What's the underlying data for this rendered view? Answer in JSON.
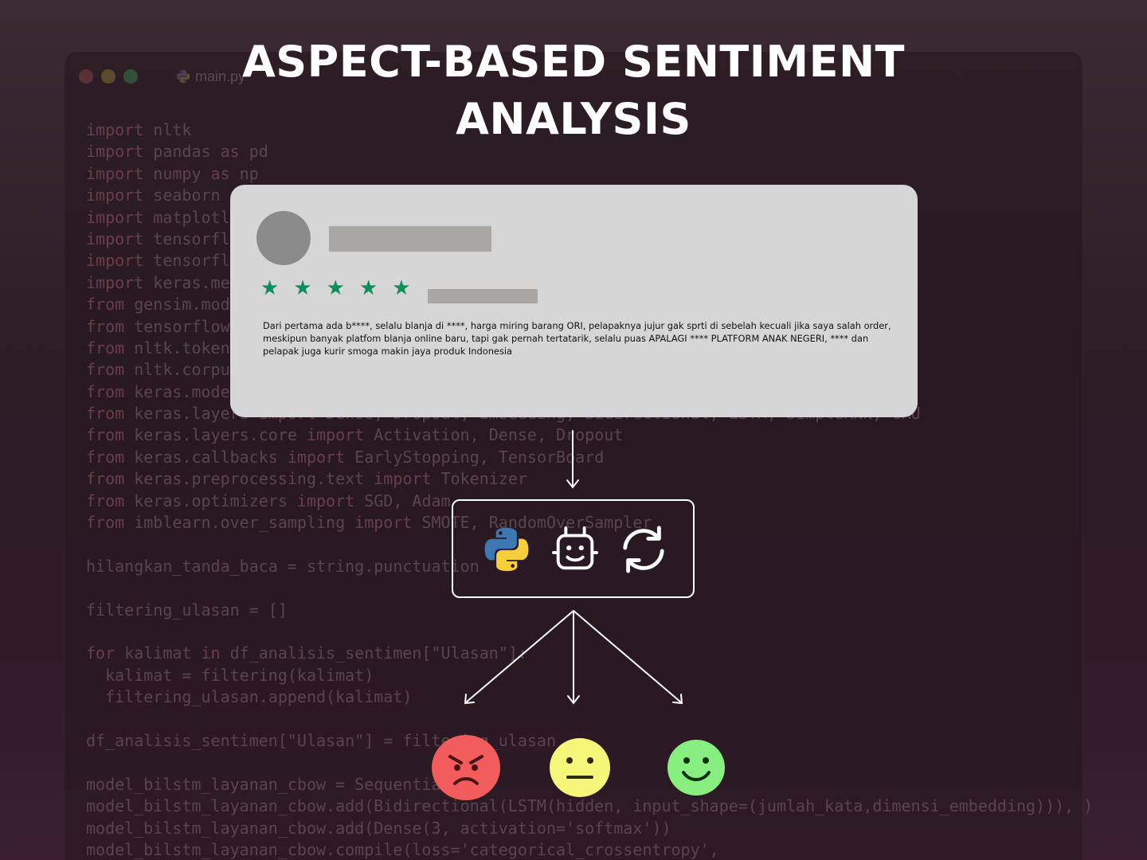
{
  "editor": {
    "tab_label": "main.py",
    "code_lines": [
      [
        {
          "k": 1,
          "t": "import"
        },
        {
          "k": 0,
          "t": " nltk"
        }
      ],
      [
        {
          "k": 1,
          "t": "import"
        },
        {
          "k": 0,
          "t": " pandas "
        },
        {
          "k": 1,
          "t": "as"
        },
        {
          "k": 0,
          "t": " pd"
        }
      ],
      [
        {
          "k": 1,
          "t": "import"
        },
        {
          "k": 0,
          "t": " numpy "
        },
        {
          "k": 1,
          "t": "as"
        },
        {
          "k": 0,
          "t": " np"
        }
      ],
      [
        {
          "k": 1,
          "t": "import"
        },
        {
          "k": 0,
          "t": " seaborn"
        }
      ],
      [
        {
          "k": 1,
          "t": "import"
        },
        {
          "k": 0,
          "t": " matplotli"
        }
      ],
      [
        {
          "k": 1,
          "t": "import"
        },
        {
          "k": 0,
          "t": " tensorflo"
        }
      ],
      [
        {
          "k": 1,
          "t": "import"
        },
        {
          "k": 0,
          "t": " tensorflo"
        }
      ],
      [
        {
          "k": 1,
          "t": "import"
        },
        {
          "k": 0,
          "t": " keras.met"
        }
      ],
      [
        {
          "k": 1,
          "t": "from"
        },
        {
          "k": 0,
          "t": " gensim.mode"
        }
      ],
      [
        {
          "k": 1,
          "t": "from"
        },
        {
          "k": 0,
          "t": " tensorflow"
        }
      ],
      [
        {
          "k": 1,
          "t": "from"
        },
        {
          "k": 0,
          "t": " nltk.tokeni"
        }
      ],
      [
        {
          "k": 1,
          "t": "from"
        },
        {
          "k": 0,
          "t": " nltk.corpus"
        }
      ],
      [
        {
          "k": 1,
          "t": "from"
        },
        {
          "k": 0,
          "t": " keras.model"
        }
      ],
      [
        {
          "k": 1,
          "t": "from"
        },
        {
          "k": 0,
          "t": " keras.layers "
        },
        {
          "k": 1,
          "t": "import"
        },
        {
          "k": 0,
          "t": " Dense, Dropout, Embedding, Bidirectional, LSTM, SimpleRNN, GRU"
        }
      ],
      [
        {
          "k": 1,
          "t": "from"
        },
        {
          "k": 0,
          "t": " keras.layers.core "
        },
        {
          "k": 1,
          "t": "import"
        },
        {
          "k": 0,
          "t": " Activation, Dense, Dropout"
        }
      ],
      [
        {
          "k": 1,
          "t": "from"
        },
        {
          "k": 0,
          "t": " keras.callbacks "
        },
        {
          "k": 1,
          "t": "import"
        },
        {
          "k": 0,
          "t": " EarlyStopping, TensorBoard"
        }
      ],
      [
        {
          "k": 1,
          "t": "from"
        },
        {
          "k": 0,
          "t": " keras.preprocessing.text "
        },
        {
          "k": 1,
          "t": "import"
        },
        {
          "k": 0,
          "t": " Tokenizer"
        }
      ],
      [
        {
          "k": 1,
          "t": "from"
        },
        {
          "k": 0,
          "t": " keras.optimizers "
        },
        {
          "k": 1,
          "t": "import"
        },
        {
          "k": 0,
          "t": " SGD, Adam"
        }
      ],
      [
        {
          "k": 1,
          "t": "from"
        },
        {
          "k": 0,
          "t": " imblearn.over_sampling "
        },
        {
          "k": 1,
          "t": "import"
        },
        {
          "k": 0,
          "t": " SMOTE, RandomOverSampler"
        }
      ],
      [],
      [
        {
          "k": 0,
          "t": "hilangkan_tanda_baca = string.punctuation"
        }
      ],
      [],
      [
        {
          "k": 0,
          "t": "filtering_ulasan = []"
        }
      ],
      [],
      [
        {
          "k": 1,
          "t": "for"
        },
        {
          "k": 0,
          "t": " kalimat "
        },
        {
          "k": 1,
          "t": "in"
        },
        {
          "k": 0,
          "t": " df_analisis_sentimen[\"Ulasan\"]:"
        }
      ],
      [
        {
          "k": 0,
          "t": "  kalimat = filtering(kalimat)"
        }
      ],
      [
        {
          "k": 0,
          "t": "  filtering_ulasan.append(kalimat)"
        }
      ],
      [],
      [
        {
          "k": 0,
          "t": "df_analisis_sentimen[\"Ulasan\"] = filtering_ulasan"
        }
      ],
      [],
      [
        {
          "k": 0,
          "t": "model_bilstm_layanan_cbow = Sequential()"
        }
      ],
      [
        {
          "k": 0,
          "t": "model_bilstm_layanan_cbow.add(Bidirectional(LSTM(hidden, input_shape=(jumlah_kata,dimensi_embedding))), )"
        }
      ],
      [
        {
          "k": 0,
          "t": "model_bilstm_layanan_cbow.add(Dense(3, activation='softmax'))"
        }
      ],
      [
        {
          "k": 0,
          "t": "model_bilstm_layanan_cbow.compile(loss='categorical_crossentropy',"
        }
      ]
    ]
  },
  "title": {
    "line1": "ASPECT-BASED SENTIMENT",
    "line2": "ANALYSIS"
  },
  "review": {
    "stars": 5,
    "star_color": "#0d8f5c",
    "text": "Dari pertama ada b****, selalu blanja di ****, harga miring barang ORI, pelapaknya jujur gak sprti di sebelah kecuali jika saya salah order, meskipun banyak platfom blanja online baru, tapi gak pernah tertatarik, selalu puas APALAGI **** PLATFORM ANAK NEGERI, **** dan pelapak juga kurir smoga makin jaya produk Indonesia"
  },
  "tools": [
    "python-icon",
    "robot-icon",
    "refresh-icon"
  ],
  "sentiments": [
    {
      "name": "negative",
      "icon": "angry-face-icon",
      "color": "#f25c5c"
    },
    {
      "name": "neutral",
      "icon": "neutral-face-icon",
      "color": "#f5f57a"
    },
    {
      "name": "positive",
      "icon": "smiling-face-icon",
      "color": "#86ef7f"
    }
  ]
}
